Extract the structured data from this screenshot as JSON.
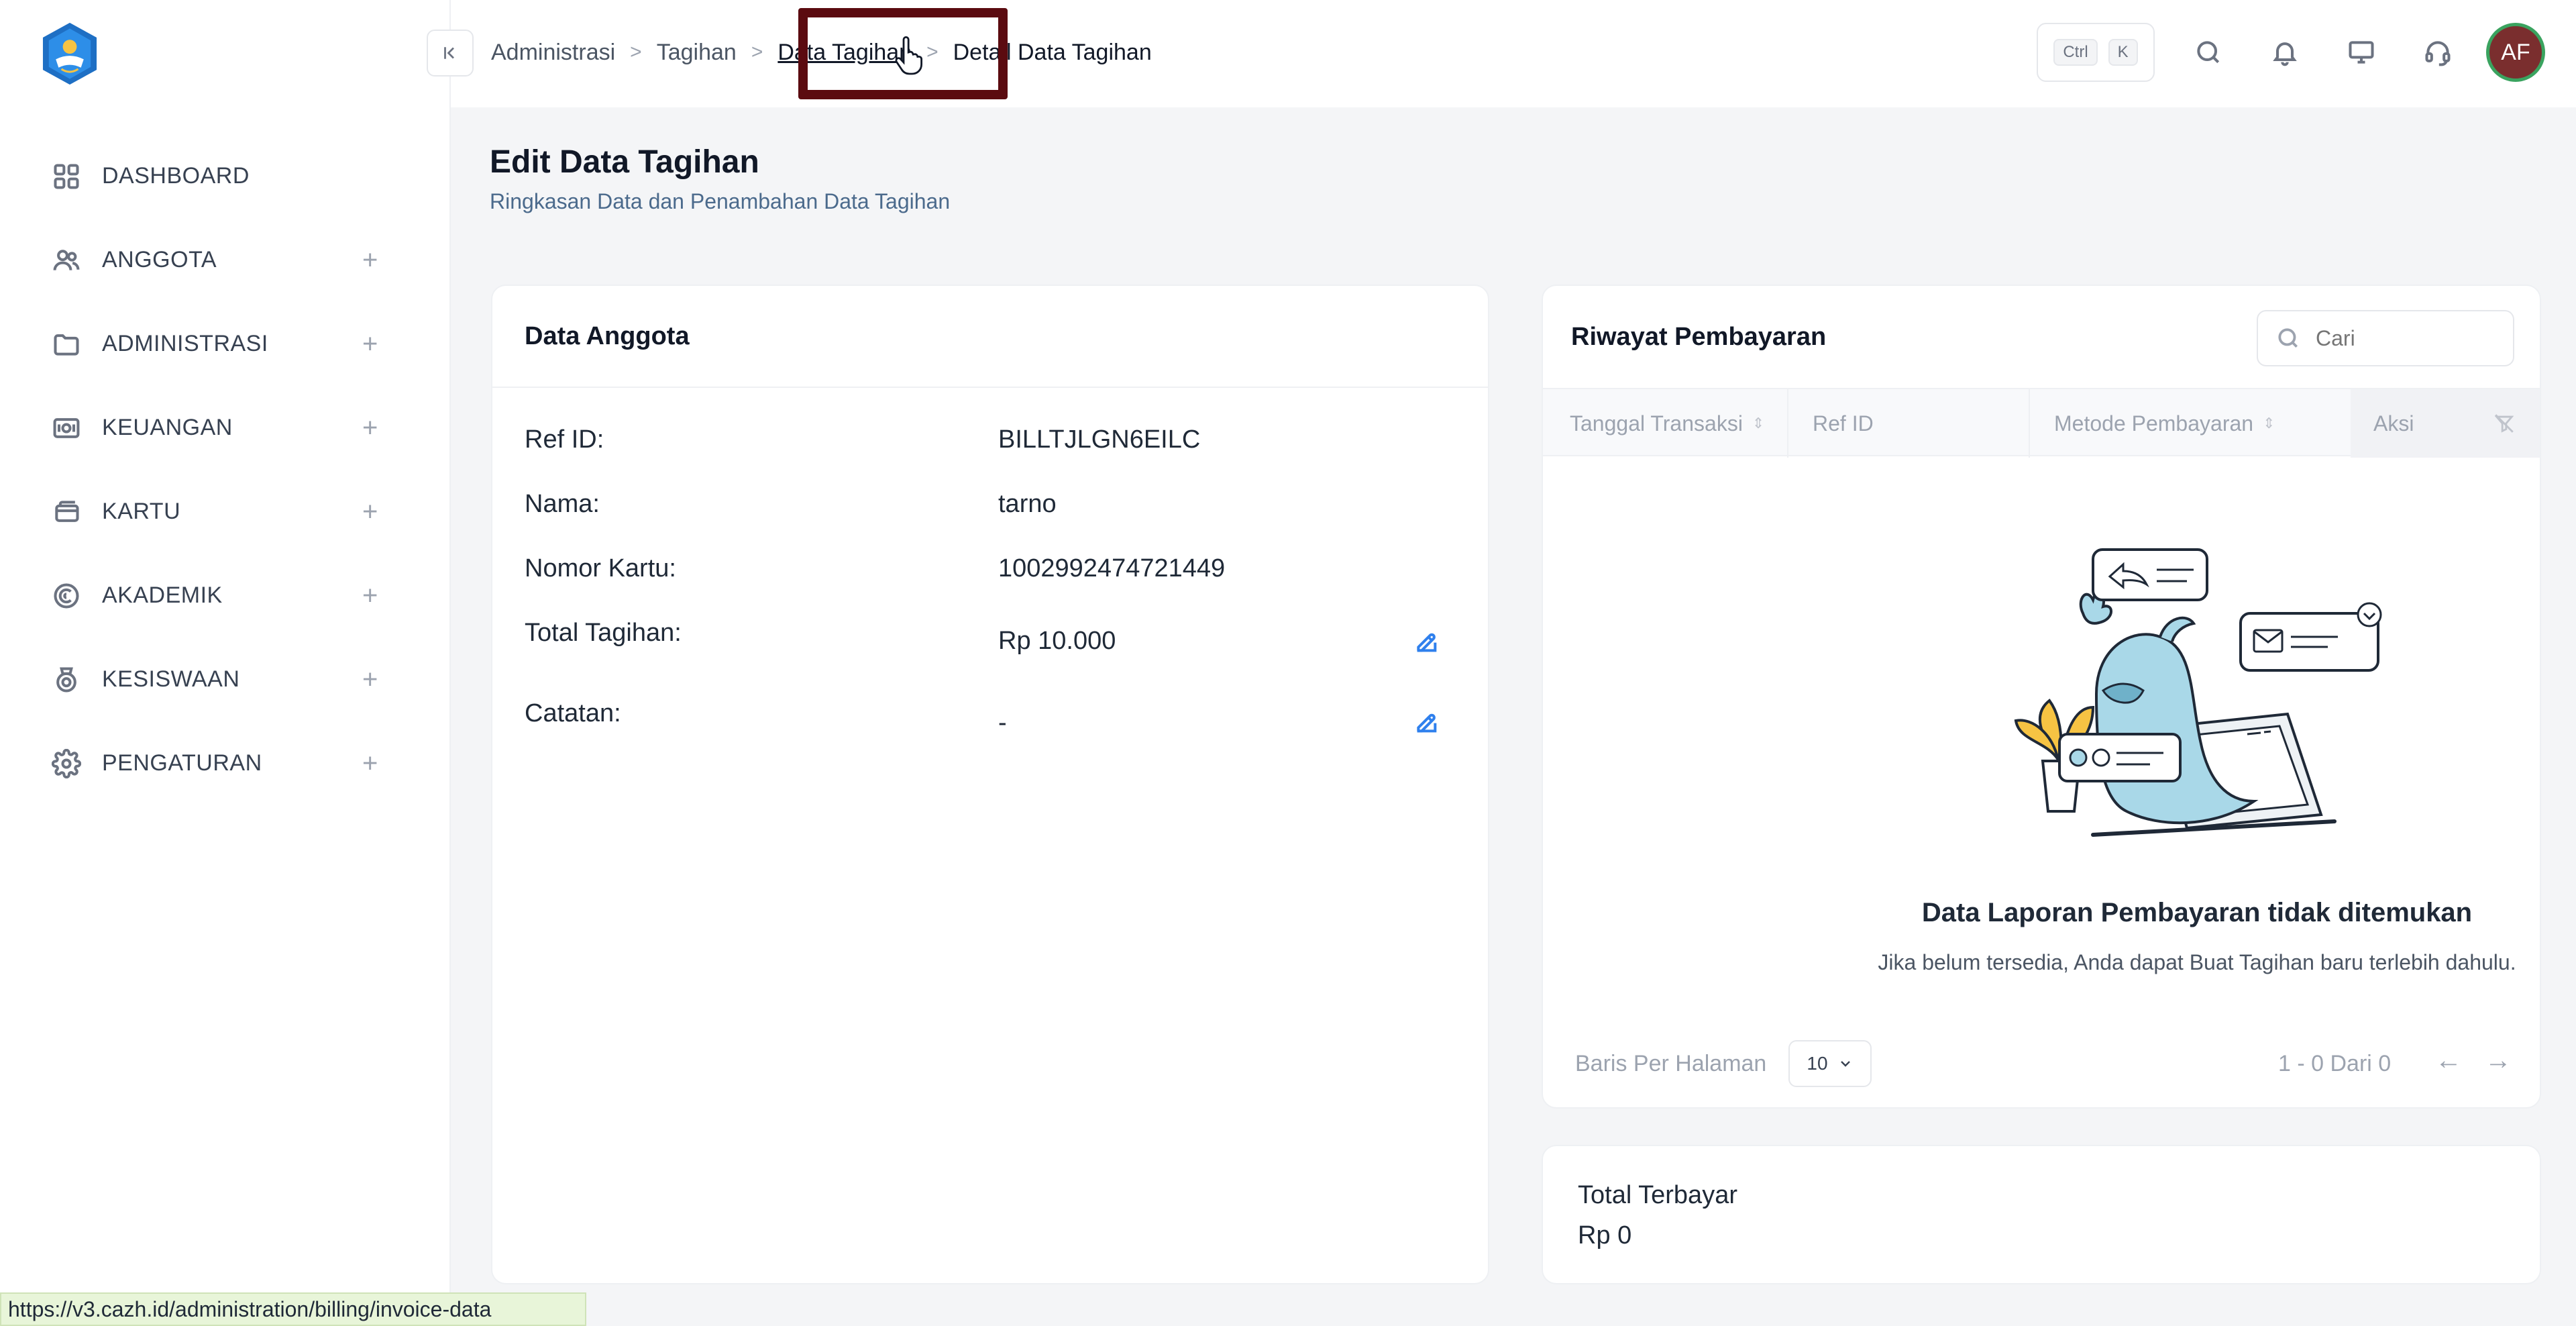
{
  "sidebar": {
    "items": [
      {
        "label": "DASHBOARD",
        "icon": "grid-icon",
        "expandable": false
      },
      {
        "label": "ANGGOTA",
        "icon": "users-icon",
        "expandable": true
      },
      {
        "label": "ADMINISTRASI",
        "icon": "folder-icon",
        "expandable": true
      },
      {
        "label": "KEUANGAN",
        "icon": "money-icon",
        "expandable": true
      },
      {
        "label": "KARTU",
        "icon": "card-icon",
        "expandable": true
      },
      {
        "label": "AKADEMIK",
        "icon": "academic-icon",
        "expandable": true
      },
      {
        "label": "KESISWAAN",
        "icon": "student-icon",
        "expandable": true
      },
      {
        "label": "PENGATURAN",
        "icon": "gear-icon",
        "expandable": true
      }
    ],
    "plus": "+"
  },
  "topbar": {
    "breadcrumb": [
      "Administrasi",
      "Tagihan",
      "Data Tagihan",
      "Detail Data Tagihan"
    ],
    "sep": ">",
    "shortcut": [
      "Ctrl",
      "K"
    ],
    "avatar_initials": "AF",
    "collapse_glyph": "|<"
  },
  "page": {
    "title": "Edit Data Tagihan",
    "subtitle": "Ringkasan Data dan Penambahan Data Tagihan"
  },
  "member_card": {
    "title": "Data Anggota",
    "rows": [
      {
        "label": "Ref ID:",
        "value": "BILLTJLGN6EILC",
        "editable": false
      },
      {
        "label": "Nama:",
        "value": "tarno",
        "editable": false
      },
      {
        "label": "Nomor Kartu:",
        "value": "1002992474721449",
        "editable": false
      },
      {
        "label": "Total Tagihan:",
        "value": "Rp 10.000",
        "editable": true
      },
      {
        "label": "Catatan:",
        "value": "-",
        "editable": true
      }
    ]
  },
  "payment_card": {
    "title": "Riwayat Pembayaran",
    "search_placeholder": "Cari",
    "columns": [
      "Tanggal Transaksi",
      "Ref ID",
      "Metode Pembayaran",
      "Aksi"
    ],
    "empty_title": "Data Laporan Pembayaran tidak ditemukan",
    "empty_subtitle": "Jika belum tersedia, Anda dapat Buat Tagihan baru terlebih dahulu.",
    "rows_per_page_label": "Baris Per Halaman",
    "rows_per_page_value": "10",
    "range_text": "1 - 0 Dari 0",
    "prev": "←",
    "next": "→"
  },
  "total_card": {
    "label": "Total Terbayar",
    "value": "Rp 0"
  },
  "status_bar": {
    "url": "https://v3.cazh.id/administration/billing/invoice-data"
  },
  "colors": {
    "accent": "#2f80ed",
    "highlight_box": "#5b0b10",
    "avatar_bg": "#7a2e2e",
    "avatar_ring": "#3aa35f"
  }
}
